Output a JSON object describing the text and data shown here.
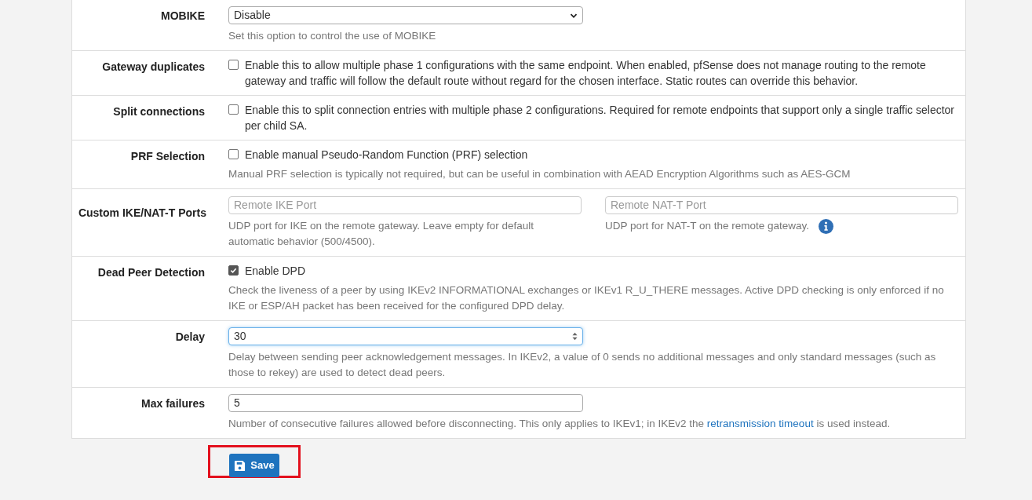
{
  "rows": [
    {
      "kind": "select",
      "label": "MOBIKE",
      "value": "Disable",
      "help": "Set this option to control the use of MOBIKE"
    },
    {
      "kind": "checkbox",
      "label": "Gateway duplicates",
      "checkbox": {
        "label": "Enable this to allow multiple phase 1 configurations with the same endpoint. When enabled, pfSense does not manage routing to the remote gateway and traffic will follow the default route without regard for the chosen interface. Static routes can override this behavior.",
        "checked": false
      }
    },
    {
      "kind": "checkbox",
      "label": "Split connections",
      "checkbox": {
        "label": "Enable this to split connection entries with multiple phase 2 configurations. Required for remote endpoints that support only a single traffic selector per child SA.",
        "checked": false
      }
    },
    {
      "kind": "checkbox",
      "label": "PRF Selection",
      "checkbox": {
        "label": "Enable manual Pseudo-Random Function (PRF) selection",
        "checked": false
      },
      "help": "Manual PRF selection is typically not required, but can be useful in combination with AEAD Encryption Algorithms such as AES-GCM"
    },
    {
      "kind": "ports",
      "label": "Custom IKE/NAT-T Ports",
      "ports": [
        {
          "placeholder": "Remote IKE Port",
          "help": "UDP port for IKE on the remote gateway. Leave empty for default automatic behavior (500/4500).",
          "info": false
        },
        {
          "placeholder": "Remote NAT-T Port",
          "help": "UDP port for NAT-T on the remote gateway.",
          "info": true
        }
      ]
    },
    {
      "kind": "checkbox",
      "label": "Dead Peer Detection",
      "checkbox": {
        "label": "Enable DPD",
        "checked": true
      },
      "help": "Check the liveness of a peer by using IKEv2 INFORMATIONAL exchanges or IKEv1 R_U_THERE messages. Active DPD checking is only enforced if no IKE or ESP/AH packet has been received for the configured DPD delay."
    },
    {
      "kind": "number",
      "label": "Delay",
      "value": "30",
      "focused": true,
      "help": "Delay between sending peer acknowledgement messages. In IKEv2, a value of 0 sends no additional messages and only standard messages (such as those to rekey) are used to detect dead peers."
    },
    {
      "kind": "text",
      "label": "Max failures",
      "value": "5",
      "help_parts": [
        {
          "text": "Number of consecutive failures allowed before disconnecting. This only applies to IKEv1; in IKEv2 the "
        },
        {
          "link": "retransmission timeout"
        },
        {
          "text": " is used instead."
        }
      ]
    }
  ],
  "save": {
    "label": "Save",
    "highlighted": true
  }
}
